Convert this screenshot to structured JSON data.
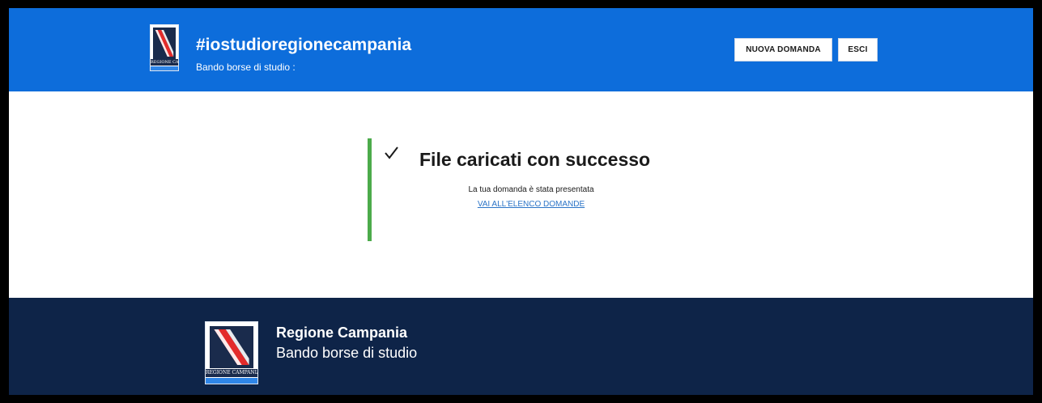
{
  "header": {
    "title": "#iostudioregionecampania",
    "subtitle": "Bando borse di studio :",
    "logo_caption": "REGIONE CAMPANIA",
    "buttons": {
      "new_application": "NUOVA DOMANDA",
      "exit": "ESCI"
    }
  },
  "main": {
    "icon": "check-icon",
    "title": "File caricati con successo",
    "message": "La tua domanda è stata presentata",
    "link": "VAI ALL'ELENCO DOMANDE"
  },
  "footer": {
    "logo_caption": "REGIONE CAMPANIA",
    "title": "Regione Campania",
    "subtitle": "Bando borse di studio"
  },
  "colors": {
    "header_bg": "#0d6ddb",
    "footer_bg": "#0e2448",
    "success_accent": "#4cab4b",
    "link": "#2b74c7"
  }
}
